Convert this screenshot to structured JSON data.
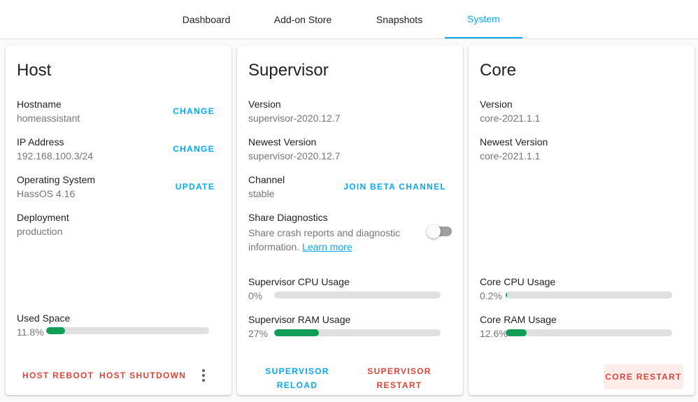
{
  "tabs": [
    {
      "label": "Dashboard"
    },
    {
      "label": "Add-on Store"
    },
    {
      "label": "Snapshots"
    },
    {
      "label": "System"
    }
  ],
  "host": {
    "title": "Host",
    "hostname_label": "Hostname",
    "hostname_value": "homeassistant",
    "hostname_action": "CHANGE",
    "ip_label": "IP Address",
    "ip_value": "192.168.100.3/24",
    "ip_action": "CHANGE",
    "os_label": "Operating System",
    "os_value": "HassOS 4.16",
    "os_action": "UPDATE",
    "deployment_label": "Deployment",
    "deployment_value": "production",
    "used_space_label": "Used Space",
    "used_space_text": "11.8%",
    "used_space_fraction": 0.118,
    "reboot_label": "HOST REBOOT",
    "shutdown_label": "HOST SHUTDOWN"
  },
  "supervisor": {
    "title": "Supervisor",
    "version_label": "Version",
    "version_value": "supervisor-2020.12.7",
    "newest_label": "Newest Version",
    "newest_value": "supervisor-2020.12.7",
    "channel_label": "Channel",
    "channel_value": "stable",
    "channel_action": "JOIN BETA CHANNEL",
    "diagnostics_label": "Share Diagnostics",
    "diagnostics_desc": "Share crash reports and diagnostic information.",
    "diagnostics_link": "Learn more",
    "diagnostics_enabled": false,
    "cpu_label": "Supervisor CPU Usage",
    "cpu_text": "0%",
    "cpu_fraction": 0.0,
    "ram_label": "Supervisor RAM Usage",
    "ram_text": "27%",
    "ram_fraction": 0.27,
    "reload_label_1": "SUPERVISOR",
    "reload_label_2": "RELOAD",
    "restart_label_1": "SUPERVISOR",
    "restart_label_2": "RESTART"
  },
  "core": {
    "title": "Core",
    "version_label": "Version",
    "version_value": "core-2021.1.1",
    "newest_label": "Newest Version",
    "newest_value": "core-2021.1.1",
    "cpu_label": "Core CPU Usage",
    "cpu_text": "0.2%",
    "cpu_fraction": 0.002,
    "ram_label": "Core RAM Usage",
    "ram_text": "12.6%",
    "ram_fraction": 0.126,
    "restart_label": "CORE RESTART"
  },
  "colors": {
    "accent": "#03a9f4",
    "danger": "#db4437",
    "bar_fill": "#0f9d58"
  }
}
